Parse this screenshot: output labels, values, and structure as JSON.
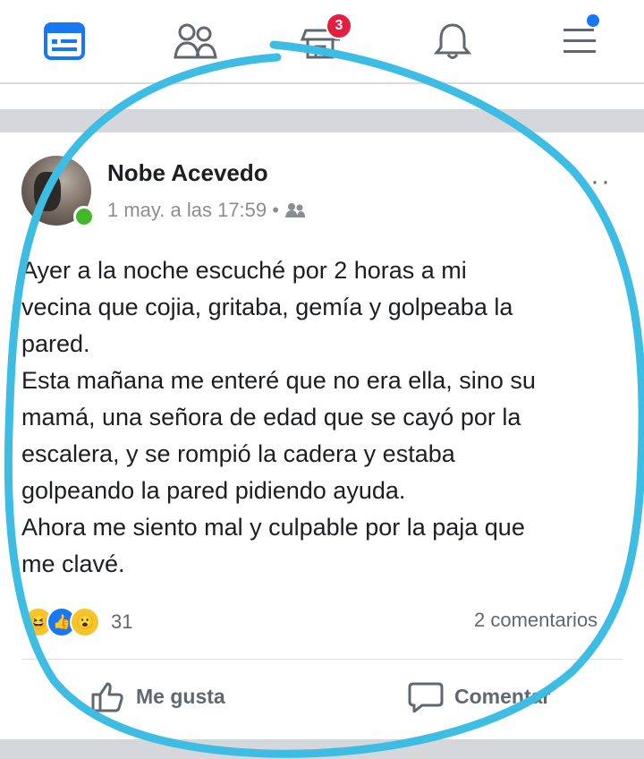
{
  "nav": {
    "items": [
      {
        "name": "news-feed",
        "icon": "news-feed-icon"
      },
      {
        "name": "friends",
        "icon": "friends-icon"
      },
      {
        "name": "marketplace",
        "icon": "marketplace-icon"
      },
      {
        "name": "notifications",
        "icon": "bell-icon"
      },
      {
        "name": "menu",
        "icon": "menu-icon"
      }
    ],
    "marketplace_badge": "3",
    "accent_color": "#1877f2"
  },
  "post": {
    "author": "Nobe Acevedo",
    "timestamp": "1 may. a las 17:59 •",
    "audience_icon": "friends-audience-icon",
    "more_label": "···",
    "text": "Ayer a la noche escuché por 2 horas a mi\nvecina que cojia, gritaba, gemía y golpeaba la\npared.\nEsta mañana me enteré que no era ella, sino su\nmamá, una señora de edad que se cayó por la\nescalera, y se rompió la cadera y estaba\ngolpeando la pared pidiendo ayuda.\nAhora me siento mal y culpable por la paja que\nme clavé.",
    "reactions": [
      "haha",
      "like",
      "wow"
    ],
    "reaction_count": "31",
    "comments_label": "2 comentarios",
    "actions": {
      "like": "Me gusta",
      "comment": "Comentar"
    }
  },
  "annotation": {
    "color": "#3dbde3",
    "shape": "hand-drawn circle"
  }
}
